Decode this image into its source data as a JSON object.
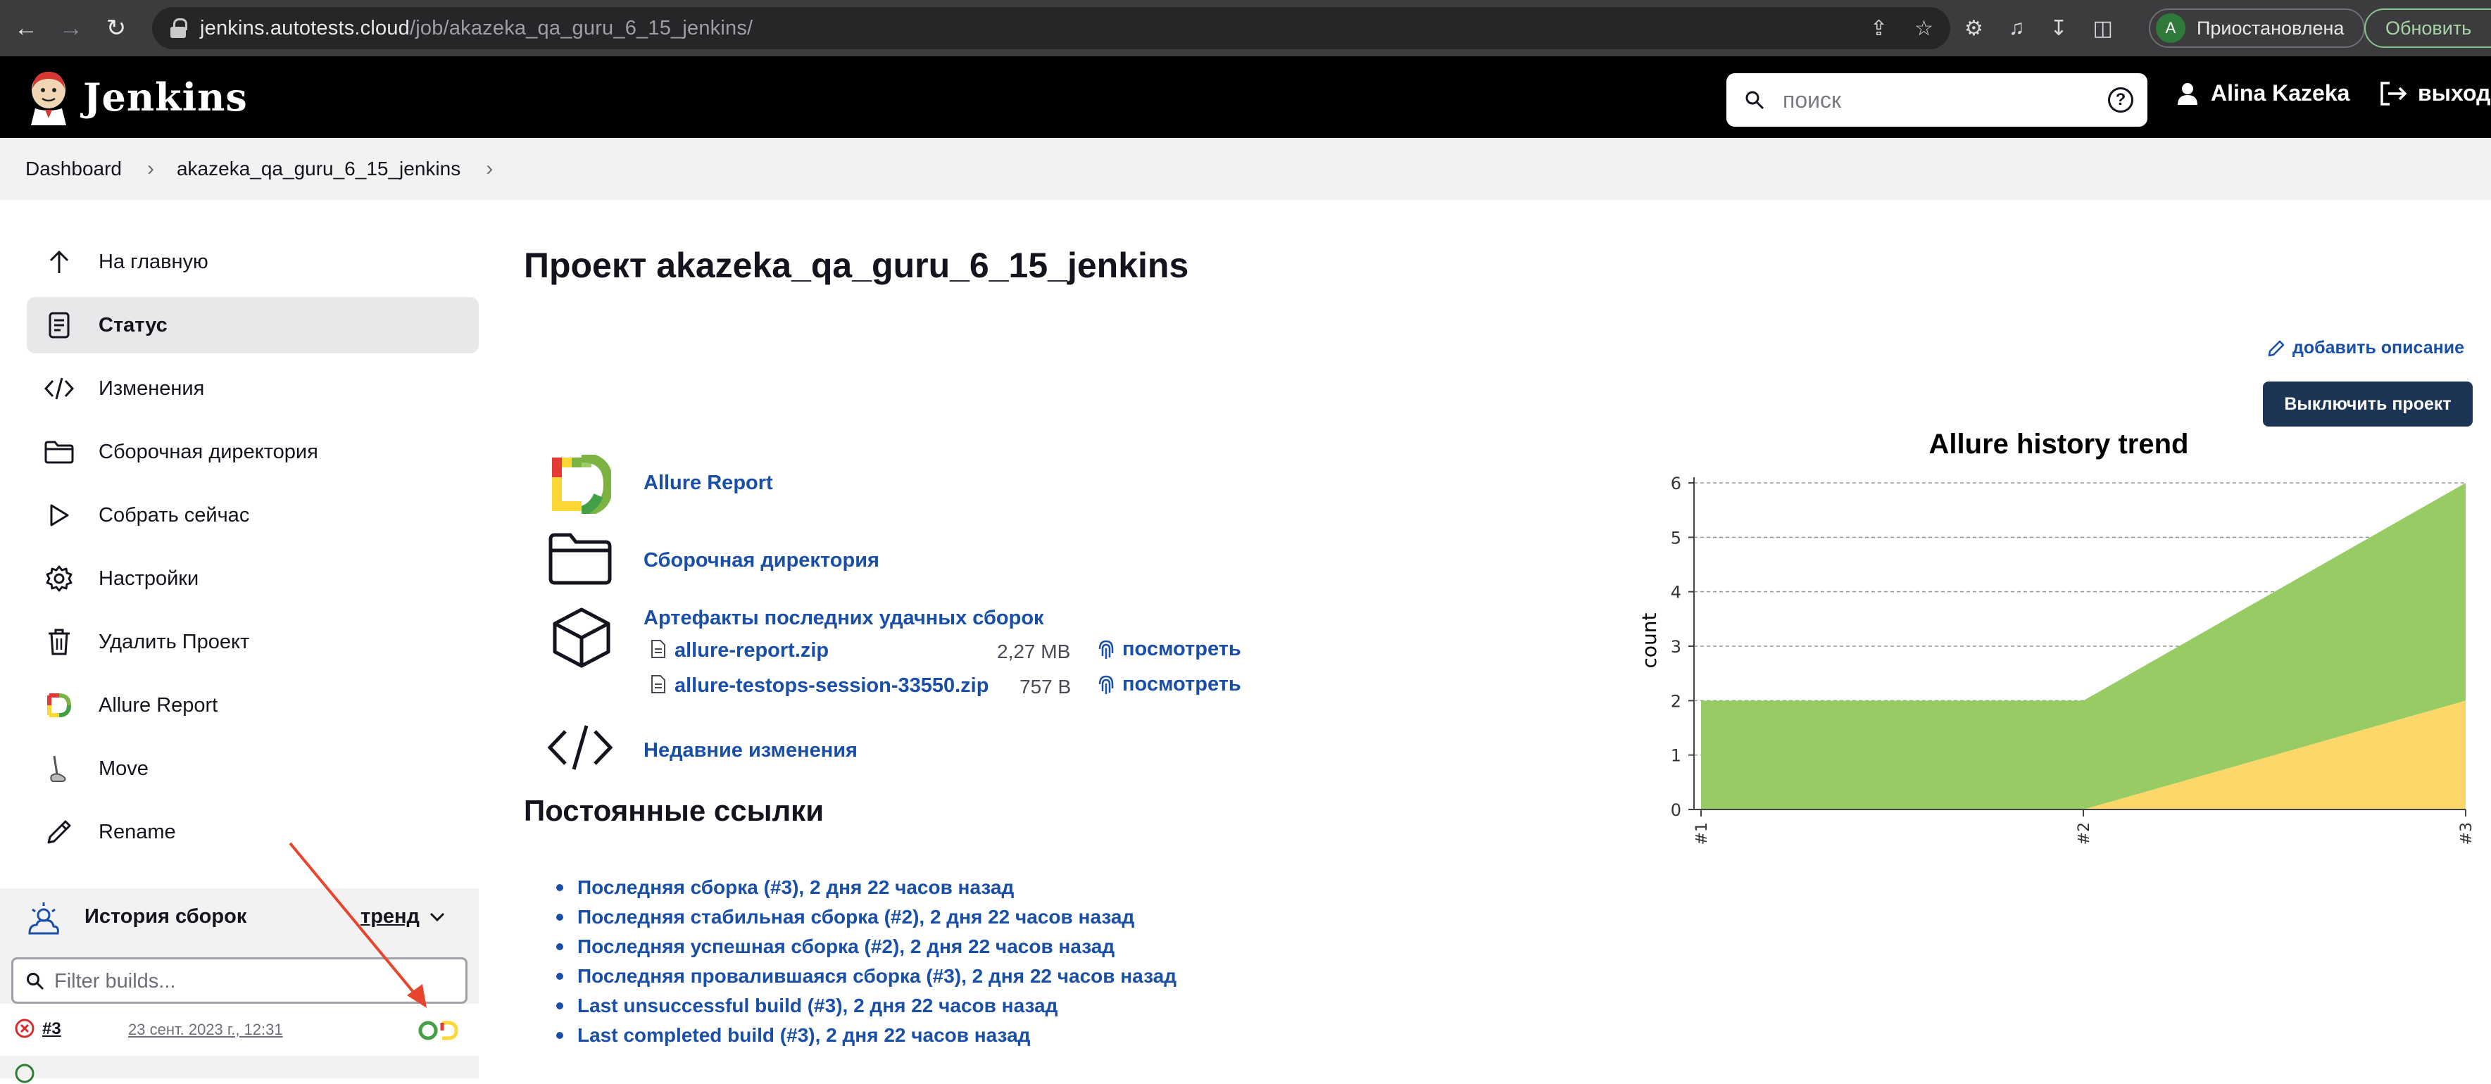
{
  "browser": {
    "url_host": "jenkins.autotests.cloud",
    "url_path": "/job/akazeka_qa_guru_6_15_jenkins/",
    "profile_initial": "A",
    "profile_status": "Приостановлена",
    "update_label": "Обновить"
  },
  "header": {
    "app_title": "Jenkins",
    "search_placeholder": "поиск",
    "help_label": "?",
    "user_name": "Alina Kazeka",
    "logout_label": "выход"
  },
  "breadcrumb": {
    "items": [
      "Dashboard",
      "akazeka_qa_guru_6_15_jenkins"
    ]
  },
  "sidebar": {
    "tasks": [
      {
        "label": "На главную",
        "icon": "arrow-up-icon"
      },
      {
        "label": "Статус",
        "icon": "document-icon",
        "active": true
      },
      {
        "label": "Изменения",
        "icon": "code-icon"
      },
      {
        "label": "Сборочная директория",
        "icon": "folder-icon"
      },
      {
        "label": "Собрать сейчас",
        "icon": "play-icon"
      },
      {
        "label": "Настройки",
        "icon": "gear-icon"
      },
      {
        "label": "Удалить Проект",
        "icon": "trash-icon"
      },
      {
        "label": "Allure Report",
        "icon": "allure-icon"
      },
      {
        "label": "Move",
        "icon": "move-icon"
      },
      {
        "label": "Rename",
        "icon": "pencil-icon"
      }
    ],
    "history": {
      "title": "История сборок",
      "trend_label": "тренд",
      "filter_placeholder": "Filter builds...",
      "builds": [
        {
          "number": "#3",
          "date": "23 сент. 2023 г., 12:31",
          "status": "failed"
        }
      ]
    }
  },
  "main": {
    "title": "Проект akazeka_qa_guru_6_15_jenkins",
    "add_description": "добавить описание",
    "disable_button": "Выключить проект",
    "links": {
      "allure_report": "Allure Report",
      "workspace": "Сборочная директория",
      "artifacts": "Артефакты последних удачных сборок",
      "recent_changes": "Недавние изменения"
    },
    "artifacts": [
      {
        "name": "allure-report.zip",
        "size": "2,27 MB",
        "view": "посмотреть"
      },
      {
        "name": "allure-testops-session-33550.zip",
        "size": "757 B",
        "view": "посмотреть"
      }
    ],
    "permalinks_title": "Постоянные ссылки",
    "permalinks": [
      "Последняя сборка (#3), 2 дня 22 часов назад",
      "Последняя стабильная сборка (#2), 2 дня 22 часов назад",
      "Последняя успешная сборка (#2), 2 дня 22 часов назад",
      "Последняя провалившаяся сборка (#3), 2 дня 22 часов назад",
      "Last unsuccessful build (#3), 2 дня 22 часов назад",
      "Last completed build (#3), 2 дня 22 часов назад"
    ]
  },
  "colors": {
    "link": "#1a4fa8",
    "button_dark": "#1d3554",
    "passed_area": "#97cc64",
    "failed_area": "#fdd76a",
    "build_failed": "#d32f2f"
  },
  "chart_data": {
    "type": "area",
    "title": "Allure history trend",
    "ylabel": "count",
    "x": [
      "#1",
      "#2",
      "#3"
    ],
    "ylim": [
      0,
      6
    ],
    "yticks": [
      "0",
      "1",
      "2",
      "3",
      "4",
      "5",
      "6"
    ],
    "series": [
      {
        "values": [
          0,
          0,
          2
        ],
        "color": "#fdd76a"
      },
      {
        "values": [
          2,
          2,
          4
        ],
        "color": "#97cc64"
      }
    ],
    "stacked": true,
    "grid": true
  }
}
